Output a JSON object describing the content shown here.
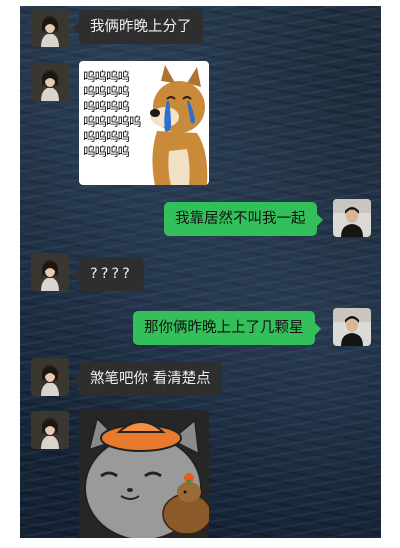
{
  "messages": [
    {
      "side": "in",
      "text": "我俩昨晚上分了"
    },
    {
      "side": "in",
      "type": "sticker",
      "sticker": "crying-shiba-doge",
      "text_lines": [
        "呜呜呜呜",
        "呜呜呜呜",
        "呜呜呜呜",
        "呜呜呜呜呜",
        "呜呜呜呜",
        "呜呜呜呜"
      ]
    },
    {
      "side": "out",
      "text": "我靠居然不叫我一起"
    },
    {
      "side": "in",
      "text": "????"
    },
    {
      "side": "out",
      "text": "那你俩昨晚上上了几颗星"
    },
    {
      "side": "in",
      "text": "煞笔吧你 看清楚点"
    },
    {
      "side": "in",
      "type": "sticker",
      "sticker": "gray-cat-with-capybara"
    }
  ],
  "colors": {
    "incoming_bubble": "#2e2e2e",
    "outgoing_bubble": "#33c05a",
    "background": "#1c2b3b"
  }
}
